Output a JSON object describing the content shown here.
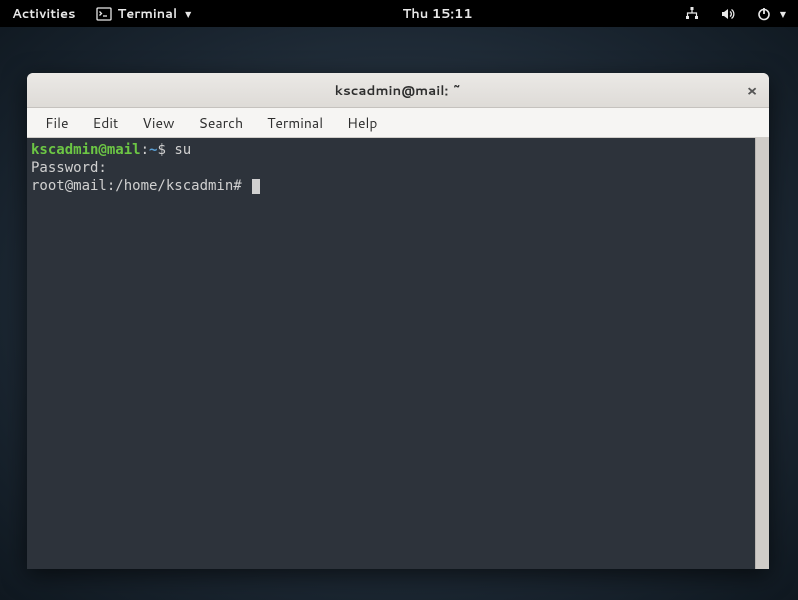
{
  "panel": {
    "activities": "Activities",
    "app_name": "Terminal",
    "clock": "Thu 15:11"
  },
  "window": {
    "title": "kscadmin@mail: ~"
  },
  "menubar": {
    "file": "File",
    "edit": "Edit",
    "view": "View",
    "search": "Search",
    "terminal": "Terminal",
    "help": "Help"
  },
  "terminal": {
    "line1_userhost": "kscadmin@mail",
    "line1_sep": ":",
    "line1_path": "~",
    "line1_prompt": "$ ",
    "line1_cmd": "su",
    "line2": "Password:",
    "line3_prompt": "root@mail:/home/kscadmin# "
  }
}
